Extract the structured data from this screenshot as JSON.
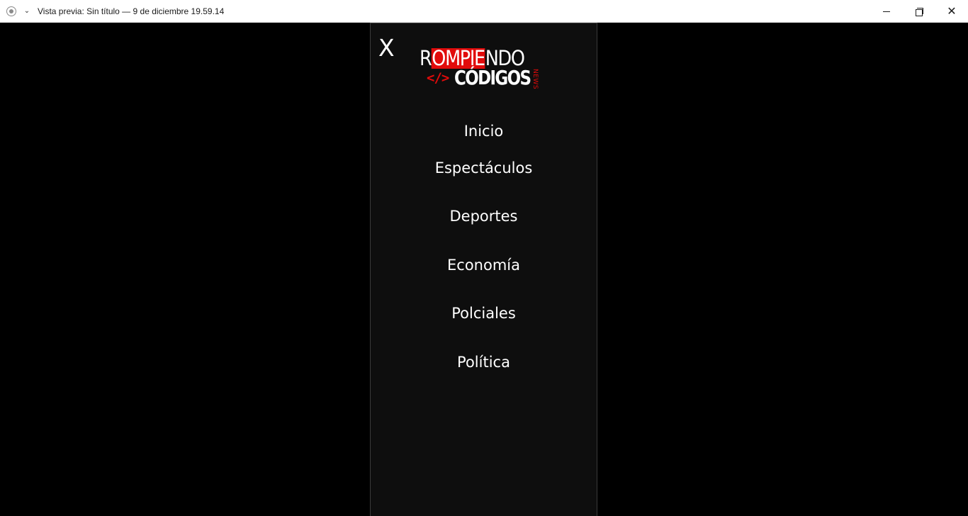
{
  "window": {
    "title": "Vista previa: Sin título — 9 de diciembre 19.59.14",
    "app_icon": "record-icon",
    "menu_icon": "chevron-down-icon",
    "controls": [
      "minimize-icon",
      "restore-icon",
      "close-icon"
    ]
  },
  "menu": {
    "close_label": "X",
    "logo": {
      "line1_pre": "R",
      "line1_highlight": "OMPIE",
      "line1_post": "NDO",
      "code_symbol": "</>",
      "line2": "CÓDIGOS",
      "tag": "NEWS"
    },
    "items": [
      {
        "label": "Inicio"
      },
      {
        "label": "Espectáculos"
      },
      {
        "label": "Deportes"
      },
      {
        "label": "Economía"
      },
      {
        "label": "Polciales"
      },
      {
        "label": "Política"
      }
    ],
    "colors": {
      "background": "#0e0e0e",
      "accent": "#e10b0b",
      "text": "#ffffff"
    }
  }
}
